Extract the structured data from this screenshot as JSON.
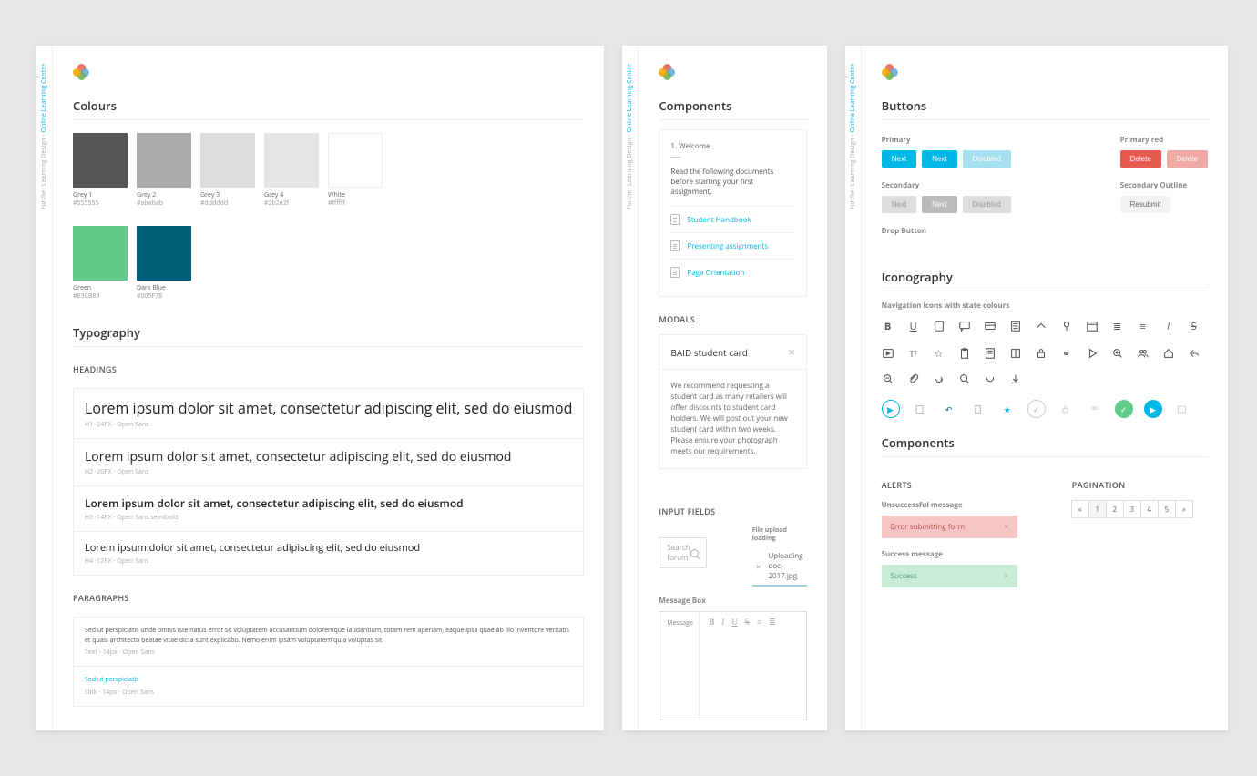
{
  "sidebar": {
    "prefix": "Further Learning Design - ",
    "brand": "Online Learning Centre"
  },
  "panel1": {
    "colours_title": "Colours",
    "swatches": [
      {
        "name": "Grey 1",
        "hex": "#555555",
        "fill": "#555555"
      },
      {
        "name": "Grey 2",
        "hex": "#ababab",
        "fill": "#ababab"
      },
      {
        "name": "Grey 3",
        "hex": "#dddddd",
        "fill": "#dddddd"
      },
      {
        "name": "Grey 4",
        "hex": "#2b2e2f",
        "fill": "#e6e6e6"
      },
      {
        "name": "White",
        "hex": "#ffffff",
        "fill": "#ffffff"
      },
      {
        "name": "Green",
        "hex": "#63CB89",
        "fill": "#63CB89"
      },
      {
        "name": "Dark Blue",
        "hex": "#005F78",
        "fill": "#005F78"
      }
    ],
    "typography_title": "Typography",
    "headings_title": "HEADINGS",
    "paragraphs_title": "PARAGRAPHS",
    "headings": [
      {
        "text": "Lorem ipsum dolor sit amet, consectetur adipiscing elit, sed do eiusmod",
        "meta": "H1 -24PX - Open Sans",
        "cls": "h1"
      },
      {
        "text": "Lorem ipsum dolor sit amet, consectetur adipiscing elit, sed do eiusmod",
        "meta": "H2 -20PX - Open Sans",
        "cls": "h2"
      },
      {
        "text": "Lorem ipsum dolor sit amet, consectetur adipiscing elit, sed do eiusmod",
        "meta": "H3 -14PX - Open Sans semibold",
        "cls": "h3"
      },
      {
        "text": "Lorem ipsum dolor sit amet, consectetur adipiscing elit, sed do eiusmod",
        "meta": "H4 -12PX - Open Sans",
        "cls": "h4"
      }
    ],
    "para_text": "Sed ut perspiciatis unde omnis iste natus error sit voluptatem accusantium doloremque laudantium, totam rem aperiam, eaque ipsa quae ab illo inventore veritatis et quasi architecto beatae vitae dicta sunt explicabo. Nemo enim ipsam voluptatem quia voluptas sit",
    "para_meta": "Text - 14px - Open Sans",
    "link_text": "Sed ut perspiciatis",
    "link_meta": "Link - 14px - Open Sans"
  },
  "panel2": {
    "components_title": "Components",
    "step": "1. Welcome",
    "intro": "Read the following documents before starting your first assignment.",
    "links": [
      "Student Handbook",
      "Presenting assignments",
      "Page Orientation"
    ],
    "modals_title": "MODALS",
    "modal_title": "BAID student card",
    "modal_body": "We recommend requesting a student card as many retailers will offer discounts to student card holders. We will post out your new student card within two weeks. Please ensure your photograph meets our requirements.",
    "inputs_title": "INPUT FIELDS",
    "search_placeholder": "Search forum",
    "upload_label": "File upload loading",
    "upload_file": "Uploading doc-2017.jpg",
    "msgbox_title": "Message Box",
    "msgbox_label": "Message"
  },
  "panel3": {
    "buttons_title": "Buttons",
    "labels": {
      "primary": "Primary",
      "primary_red": "Primary red",
      "secondary": "Secondary",
      "secondary_outline": "Secondary Outline",
      "drop": "Drop Button",
      "next": "Next",
      "disabled": "Disabled",
      "delete": "Delete",
      "resubmit": "Resubmit"
    },
    "iconography_title": "Iconography",
    "icon_sub": "Navigation icons with state colours",
    "components_title": "Components",
    "alerts_title": "ALERTS",
    "pagination_title": "PAGINATION",
    "err_label": "Unsuccessful message",
    "err_text": "Error submitting form",
    "ok_label": "Success message",
    "ok_text": "Success",
    "pages": [
      "«",
      "1",
      "2",
      "3",
      "4",
      "5",
      "»"
    ]
  }
}
